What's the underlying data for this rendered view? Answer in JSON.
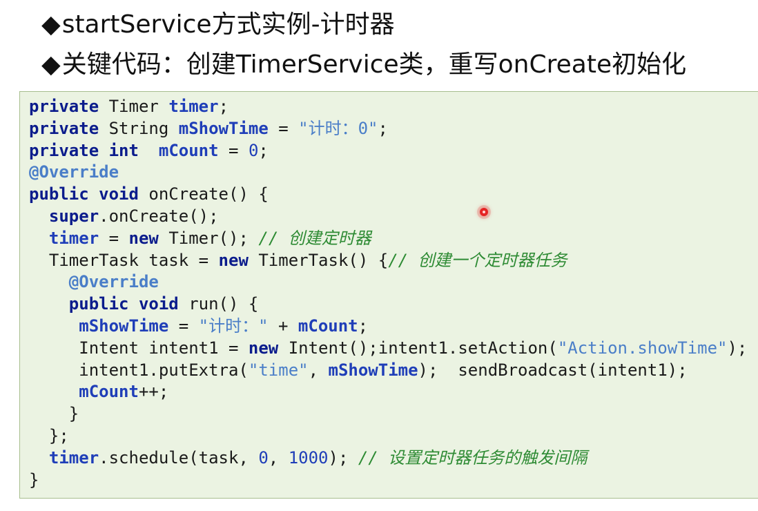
{
  "headings": {
    "bullet": "◆",
    "line1": "startService方式实例-计时器",
    "line2": "关键代码：创建TimerService类，重写onCreate初始化"
  },
  "code": [
    [
      {
        "t": "kw",
        "s": "private"
      },
      {
        "t": "p",
        "s": " Timer "
      },
      {
        "t": "fld",
        "s": "timer"
      },
      {
        "t": "p",
        "s": ";"
      }
    ],
    [
      {
        "t": "kw",
        "s": "private"
      },
      {
        "t": "p",
        "s": " String "
      },
      {
        "t": "fld",
        "s": "mShowTime"
      },
      {
        "t": "p",
        "s": " = "
      },
      {
        "t": "str",
        "s": "\"计时：0\""
      },
      {
        "t": "p",
        "s": ";"
      }
    ],
    [
      {
        "t": "kw",
        "s": "private"
      },
      {
        "t": "p",
        "s": " "
      },
      {
        "t": "kw",
        "s": "int"
      },
      {
        "t": "p",
        "s": "  "
      },
      {
        "t": "fld",
        "s": "mCount"
      },
      {
        "t": "p",
        "s": " = "
      },
      {
        "t": "num",
        "s": "0"
      },
      {
        "t": "p",
        "s": ";"
      }
    ],
    [
      {
        "t": "ann",
        "s": "@Override"
      }
    ],
    [
      {
        "t": "kw",
        "s": "public"
      },
      {
        "t": "p",
        "s": " "
      },
      {
        "t": "kw",
        "s": "void"
      },
      {
        "t": "p",
        "s": " onCreate() {"
      }
    ],
    [
      {
        "t": "p",
        "s": "  "
      },
      {
        "t": "kw",
        "s": "super"
      },
      {
        "t": "p",
        "s": ".onCreate();"
      }
    ],
    [
      {
        "t": "p",
        "s": "  "
      },
      {
        "t": "fld",
        "s": "timer"
      },
      {
        "t": "p",
        "s": " = "
      },
      {
        "t": "kw",
        "s": "new"
      },
      {
        "t": "p",
        "s": " Timer(); "
      },
      {
        "t": "cmt",
        "s": "// 创建定时器"
      }
    ],
    [
      {
        "t": "p",
        "s": "  TimerTask task = "
      },
      {
        "t": "kw",
        "s": "new"
      },
      {
        "t": "p",
        "s": " TimerTask() {"
      },
      {
        "t": "cmt",
        "s": "// 创建一个定时器任务"
      }
    ],
    [
      {
        "t": "p",
        "s": "    "
      },
      {
        "t": "ann",
        "s": "@Override"
      }
    ],
    [
      {
        "t": "p",
        "s": "    "
      },
      {
        "t": "kw",
        "s": "public"
      },
      {
        "t": "p",
        "s": " "
      },
      {
        "t": "kw",
        "s": "void"
      },
      {
        "t": "p",
        "s": " run() {"
      }
    ],
    [
      {
        "t": "p",
        "s": "     "
      },
      {
        "t": "fld",
        "s": "mShowTime"
      },
      {
        "t": "p",
        "s": " = "
      },
      {
        "t": "str",
        "s": "\"计时：\""
      },
      {
        "t": "p",
        "s": " + "
      },
      {
        "t": "fld",
        "s": "mCount"
      },
      {
        "t": "p",
        "s": ";"
      }
    ],
    [
      {
        "t": "p",
        "s": "     Intent intent1 = "
      },
      {
        "t": "kw",
        "s": "new"
      },
      {
        "t": "p",
        "s": " Intent();intent1.setAction("
      },
      {
        "t": "str",
        "s": "\"Action.showTime\""
      },
      {
        "t": "p",
        "s": ");"
      }
    ],
    [
      {
        "t": "p",
        "s": "     intent1.putExtra("
      },
      {
        "t": "str",
        "s": "\"time\""
      },
      {
        "t": "p",
        "s": ", "
      },
      {
        "t": "fld",
        "s": "mShowTime"
      },
      {
        "t": "p",
        "s": ");  sendBroadcast(intent1);"
      }
    ],
    [
      {
        "t": "p",
        "s": "     "
      },
      {
        "t": "fld",
        "s": "mCount"
      },
      {
        "t": "p",
        "s": "++;"
      }
    ],
    [
      {
        "t": "p",
        "s": "    }"
      }
    ],
    [
      {
        "t": "p",
        "s": "  };"
      }
    ],
    [
      {
        "t": "p",
        "s": "  "
      },
      {
        "t": "fld",
        "s": "timer"
      },
      {
        "t": "p",
        "s": ".schedule(task, "
      },
      {
        "t": "num",
        "s": "0"
      },
      {
        "t": "p",
        "s": ", "
      },
      {
        "t": "num",
        "s": "1000"
      },
      {
        "t": "p",
        "s": "); "
      },
      {
        "t": "cmt",
        "s": "// 设置定时器任务的触发间隔"
      }
    ],
    [
      {
        "t": "p",
        "s": "}"
      }
    ]
  ]
}
